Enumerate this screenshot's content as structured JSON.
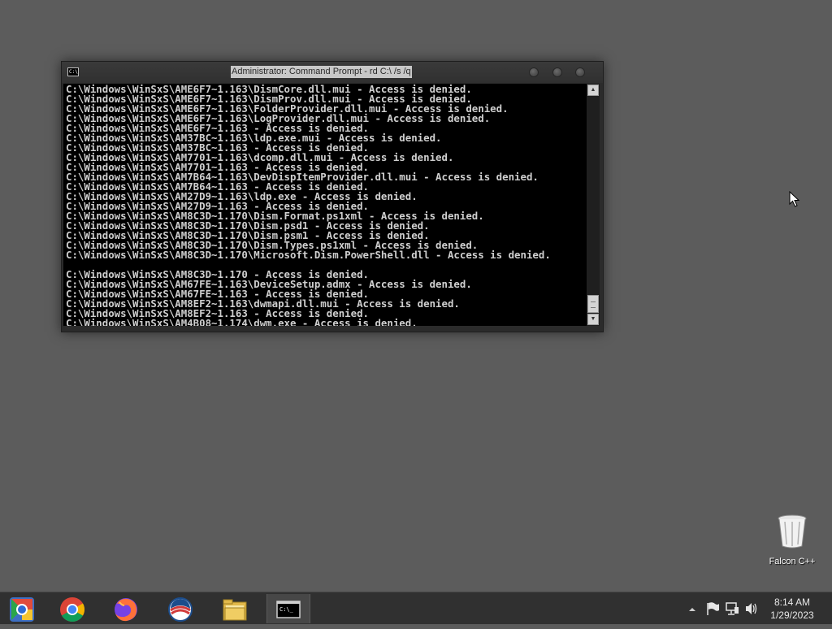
{
  "window": {
    "title": "Administrator: Command Prompt - rd  C:\\ /s /q",
    "icon_text": "C:\\"
  },
  "console": {
    "lines": [
      "C:\\Windows\\WinSxS\\AME6F7~1.163\\DismCore.dll.mui - Access is denied.",
      "C:\\Windows\\WinSxS\\AME6F7~1.163\\DismProv.dll.mui - Access is denied.",
      "C:\\Windows\\WinSxS\\AME6F7~1.163\\FolderProvider.dll.mui - Access is denied.",
      "C:\\Windows\\WinSxS\\AME6F7~1.163\\LogProvider.dll.mui - Access is denied.",
      "C:\\Windows\\WinSxS\\AME6F7~1.163 - Access is denied.",
      "C:\\Windows\\WinSxS\\AM37BC~1.163\\ldp.exe.mui - Access is denied.",
      "C:\\Windows\\WinSxS\\AM37BC~1.163 - Access is denied.",
      "C:\\Windows\\WinSxS\\AM7701~1.163\\dcomp.dll.mui - Access is denied.",
      "C:\\Windows\\WinSxS\\AM7701~1.163 - Access is denied.",
      "C:\\Windows\\WinSxS\\AM7B64~1.163\\DevDispItemProvider.dll.mui - Access is denied.",
      "C:\\Windows\\WinSxS\\AM7B64~1.163 - Access is denied.",
      "C:\\Windows\\WinSxS\\AM27D9~1.163\\ldp.exe - Access is denied.",
      "C:\\Windows\\WinSxS\\AM27D9~1.163 - Access is denied.",
      "C:\\Windows\\WinSxS\\AM8C3D~1.170\\Dism.Format.ps1xml - Access is denied.",
      "C:\\Windows\\WinSxS\\AM8C3D~1.170\\Dism.psd1 - Access is denied.",
      "C:\\Windows\\WinSxS\\AM8C3D~1.170\\Dism.psm1 - Access is denied.",
      "C:\\Windows\\WinSxS\\AM8C3D~1.170\\Dism.Types.ps1xml - Access is denied.",
      "C:\\Windows\\WinSxS\\AM8C3D~1.170\\Microsoft.Dism.PowerShell.dll - Access is denied.",
      "",
      "C:\\Windows\\WinSxS\\AM8C3D~1.170 - Access is denied.",
      "C:\\Windows\\WinSxS\\AM67FE~1.163\\DeviceSetup.admx - Access is denied.",
      "C:\\Windows\\WinSxS\\AM67FE~1.163 - Access is denied.",
      "C:\\Windows\\WinSxS\\AM8EF2~1.163\\dwmapi.dll.mui - Access is denied.",
      "C:\\Windows\\WinSxS\\AM8EF2~1.163 - Access is denied.",
      "C:\\Windows\\WinSxS\\AM4B08~1.174\\dwm.exe - Access is denied."
    ]
  },
  "desktop": {
    "icons": [
      {
        "label": "Falcon C++",
        "icon": "recycle-bin-icon"
      }
    ]
  },
  "taskbar": {
    "items": [
      {
        "name": "start-button",
        "icon": "start-orb-icon"
      },
      {
        "name": "chrome",
        "icon": "chrome-icon"
      },
      {
        "name": "firefox",
        "icon": "firefox-icon"
      },
      {
        "name": "app-blue-white",
        "icon": "circle-logo-icon"
      },
      {
        "name": "file-explorer",
        "icon": "folder-icon"
      },
      {
        "name": "command-prompt",
        "icon": "cmd-icon",
        "active": true
      }
    ],
    "clock": {
      "time": "8:14 AM",
      "date": "1/29/2023"
    }
  }
}
